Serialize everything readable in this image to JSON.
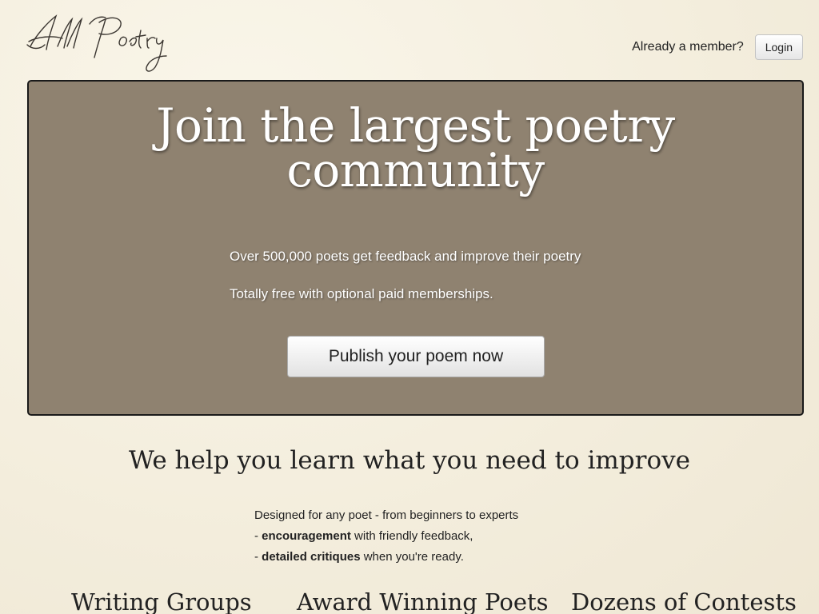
{
  "header": {
    "logo_text": "All Poetry",
    "member_prompt": "Already a member?",
    "login_label": "Login"
  },
  "hero": {
    "title": "Join the largest poetry community",
    "line1": "Over 500,000 poets get feedback and improve their poetry",
    "line2": "Totally free with optional paid memberships.",
    "cta_label": "Publish your poem now"
  },
  "learn": {
    "title": "We help you learn what you need to improve",
    "intro": "Designed for any poet - from beginners to experts",
    "item1_prefix": "- ",
    "item1_bold": "encouragement",
    "item1_rest": " with friendly feedback,",
    "item2_prefix": "- ",
    "item2_bold": "detailed critiques",
    "item2_rest": " when you're ready."
  },
  "features": {
    "col1": "Writing Groups",
    "col2": "Award Winning Poets",
    "col3": "Dozens of Contests"
  },
  "colors": {
    "background": "#f6f1e2",
    "hero_bg": "#8f8270",
    "hero_text": "#ffffff"
  }
}
